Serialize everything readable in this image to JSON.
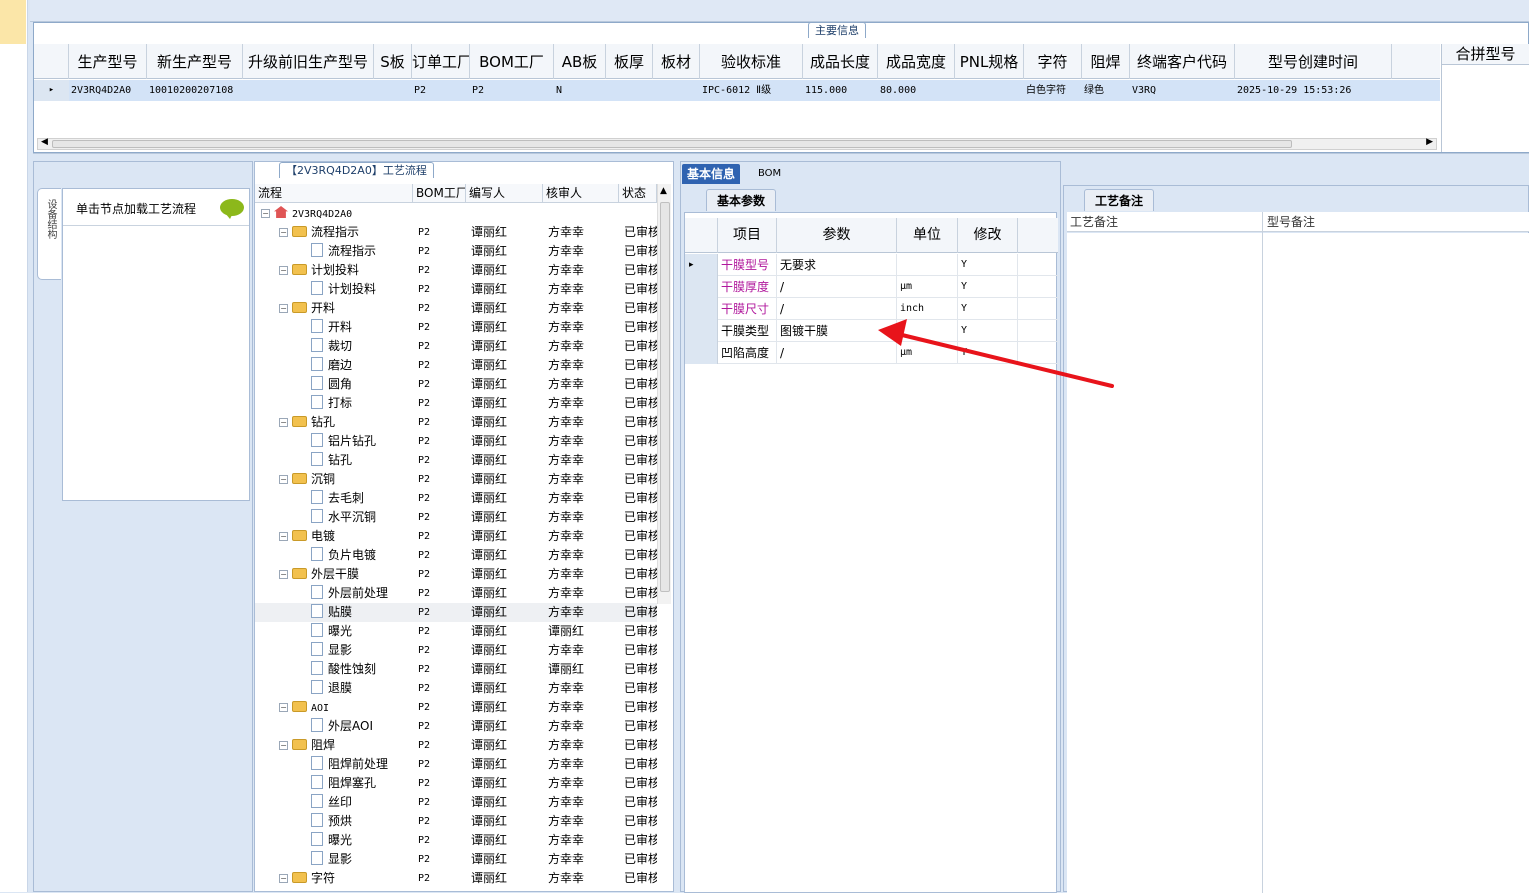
{
  "main_info": {
    "caption": "主要信息",
    "columns": [
      "生产型号",
      "新生产型号",
      "升级前旧生产型号",
      "S板",
      "订单工厂",
      "BOM工厂",
      "AB板",
      "板厚",
      "板材",
      "验收标准",
      "成品长度",
      "成品宽度",
      "PNL规格",
      "字符",
      "阻焊",
      "终端客户代码",
      "型号创建时间"
    ],
    "row": [
      "2V3RQ4D2A0",
      "10010200207108",
      "",
      "",
      "P2",
      "P2",
      "N",
      "",
      "",
      "IPC-6012 Ⅱ级",
      "115.000",
      "80.000",
      "",
      "白色字符",
      "绿色",
      "V3RQ",
      "2025-10-29 15:53:26"
    ],
    "side_header": "合拼型号"
  },
  "structure": {
    "side_tab": "设备结构",
    "hint": "单击节点加载工艺流程"
  },
  "flow": {
    "caption": "【2V3RQ4D2A0】工艺流程",
    "headers": [
      "流程",
      "BOM工厂",
      "编写人",
      "核审人",
      "状态"
    ],
    "rows": [
      {
        "name": "2V3RQ4D2A0",
        "type": "root",
        "bom": "",
        "writer": "",
        "reviewer": "",
        "status": ""
      },
      {
        "name": "流程指示",
        "type": "folder",
        "bom": "P2",
        "writer": "谭丽红",
        "reviewer": "方幸幸",
        "status": "已审核"
      },
      {
        "name": "流程指示",
        "type": "leaf",
        "bom": "P2",
        "writer": "谭丽红",
        "reviewer": "方幸幸",
        "status": "已审核"
      },
      {
        "name": "计划投料",
        "type": "folder",
        "bom": "P2",
        "writer": "谭丽红",
        "reviewer": "方幸幸",
        "status": "已审核"
      },
      {
        "name": "计划投料",
        "type": "leaf",
        "bom": "P2",
        "writer": "谭丽红",
        "reviewer": "方幸幸",
        "status": "已审核"
      },
      {
        "name": "开料",
        "type": "folder",
        "bom": "P2",
        "writer": "谭丽红",
        "reviewer": "方幸幸",
        "status": "已审核"
      },
      {
        "name": "开料",
        "type": "leaf",
        "bom": "P2",
        "writer": "谭丽红",
        "reviewer": "方幸幸",
        "status": "已审核"
      },
      {
        "name": "裁切",
        "type": "leaf",
        "bom": "P2",
        "writer": "谭丽红",
        "reviewer": "方幸幸",
        "status": "已审核"
      },
      {
        "name": "磨边",
        "type": "leaf",
        "bom": "P2",
        "writer": "谭丽红",
        "reviewer": "方幸幸",
        "status": "已审核"
      },
      {
        "name": "圆角",
        "type": "leaf",
        "bom": "P2",
        "writer": "谭丽红",
        "reviewer": "方幸幸",
        "status": "已审核"
      },
      {
        "name": "打标",
        "type": "leaf",
        "bom": "P2",
        "writer": "谭丽红",
        "reviewer": "方幸幸",
        "status": "已审核"
      },
      {
        "name": "钻孔",
        "type": "folder",
        "bom": "P2",
        "writer": "谭丽红",
        "reviewer": "方幸幸",
        "status": "已审核"
      },
      {
        "name": "铝片钻孔",
        "type": "leaf",
        "bom": "P2",
        "writer": "谭丽红",
        "reviewer": "方幸幸",
        "status": "已审核"
      },
      {
        "name": "钻孔",
        "type": "leaf",
        "bom": "P2",
        "writer": "谭丽红",
        "reviewer": "方幸幸",
        "status": "已审核"
      },
      {
        "name": "沉铜",
        "type": "folder",
        "bom": "P2",
        "writer": "谭丽红",
        "reviewer": "方幸幸",
        "status": "已审核"
      },
      {
        "name": "去毛刺",
        "type": "leaf",
        "bom": "P2",
        "writer": "谭丽红",
        "reviewer": "方幸幸",
        "status": "已审核"
      },
      {
        "name": "水平沉铜",
        "type": "leaf",
        "bom": "P2",
        "writer": "谭丽红",
        "reviewer": "方幸幸",
        "status": "已审核"
      },
      {
        "name": "电镀",
        "type": "folder",
        "bom": "P2",
        "writer": "谭丽红",
        "reviewer": "方幸幸",
        "status": "已审核"
      },
      {
        "name": "负片电镀",
        "type": "leaf",
        "bom": "P2",
        "writer": "谭丽红",
        "reviewer": "方幸幸",
        "status": "已审核"
      },
      {
        "name": "外层干膜",
        "type": "folder",
        "bom": "P2",
        "writer": "谭丽红",
        "reviewer": "方幸幸",
        "status": "已审核"
      },
      {
        "name": "外层前处理",
        "type": "leaf",
        "bom": "P2",
        "writer": "谭丽红",
        "reviewer": "方幸幸",
        "status": "已审核"
      },
      {
        "name": "贴膜",
        "type": "leaf",
        "bom": "P2",
        "writer": "谭丽红",
        "reviewer": "方幸幸",
        "status": "已审核",
        "selected": true
      },
      {
        "name": "曝光",
        "type": "leaf",
        "bom": "P2",
        "writer": "谭丽红",
        "reviewer": "谭丽红",
        "status": "已审核"
      },
      {
        "name": "显影",
        "type": "leaf",
        "bom": "P2",
        "writer": "谭丽红",
        "reviewer": "方幸幸",
        "status": "已审核"
      },
      {
        "name": "酸性蚀刻",
        "type": "leaf",
        "bom": "P2",
        "writer": "谭丽红",
        "reviewer": "谭丽红",
        "status": "已审核"
      },
      {
        "name": "退膜",
        "type": "leaf",
        "bom": "P2",
        "writer": "谭丽红",
        "reviewer": "方幸幸",
        "status": "已审核"
      },
      {
        "name": "AOI",
        "type": "folder",
        "bom": "P2",
        "writer": "谭丽红",
        "reviewer": "方幸幸",
        "status": "已审核"
      },
      {
        "name": "外层AOI",
        "type": "leaf",
        "bom": "P2",
        "writer": "谭丽红",
        "reviewer": "方幸幸",
        "status": "已审核"
      },
      {
        "name": "阻焊",
        "type": "folder",
        "bom": "P2",
        "writer": "谭丽红",
        "reviewer": "方幸幸",
        "status": "已审核"
      },
      {
        "name": "阻焊前处理",
        "type": "leaf",
        "bom": "P2",
        "writer": "谭丽红",
        "reviewer": "方幸幸",
        "status": "已审核"
      },
      {
        "name": "阻焊塞孔",
        "type": "leaf",
        "bom": "P2",
        "writer": "谭丽红",
        "reviewer": "方幸幸",
        "status": "已审核"
      },
      {
        "name": "丝印",
        "type": "leaf",
        "bom": "P2",
        "writer": "谭丽红",
        "reviewer": "方幸幸",
        "status": "已审核"
      },
      {
        "name": "预烘",
        "type": "leaf",
        "bom": "P2",
        "writer": "谭丽红",
        "reviewer": "方幸幸",
        "status": "已审核"
      },
      {
        "name": "曝光",
        "type": "leaf",
        "bom": "P2",
        "writer": "谭丽红",
        "reviewer": "方幸幸",
        "status": "已审核"
      },
      {
        "name": "显影",
        "type": "leaf",
        "bom": "P2",
        "writer": "谭丽红",
        "reviewer": "方幸幸",
        "status": "已审核"
      },
      {
        "name": "字符",
        "type": "folder",
        "bom": "P2",
        "writer": "谭丽红",
        "reviewer": "方幸幸",
        "status": "已审核"
      }
    ]
  },
  "info": {
    "tabs": [
      "基本信息",
      "BOM"
    ],
    "subtab": "基本参数",
    "headers": [
      "项目",
      "参数",
      "单位",
      "修改"
    ],
    "rows": [
      {
        "item": "干膜型号",
        "param": "无要求",
        "unit": "",
        "modify": "Y",
        "highlight": true
      },
      {
        "item": "干膜厚度",
        "param": "/",
        "unit": "μm",
        "modify": "Y",
        "highlight": true
      },
      {
        "item": "干膜尺寸",
        "param": "/",
        "unit": "inch",
        "modify": "Y",
        "highlight": true
      },
      {
        "item": "干膜类型",
        "param": "图镀干膜",
        "unit": "",
        "modify": "Y",
        "highlight": false
      },
      {
        "item": "凹陷高度",
        "param": "/",
        "unit": "μm",
        "modify": "Y",
        "highlight": false
      }
    ]
  },
  "remarks": {
    "subtab": "工艺备注",
    "headers": [
      "工艺备注",
      "型号备注"
    ]
  },
  "colors": {
    "accent": "#2f63b1",
    "highlight_text": "#b0179c",
    "annotation_arrow": "#e8141b",
    "selection": "#d3e3f7"
  }
}
